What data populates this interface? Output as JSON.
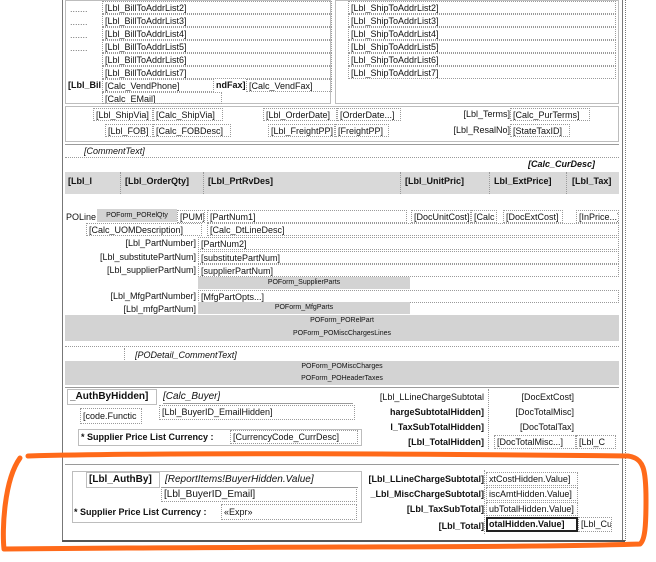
{
  "bill_to": {
    "small_labels": [
      ".......",
      ".......",
      ".......",
      "......."
    ],
    "lines": [
      "[Lbl_BillToAddrList2]",
      "[Lbl_BillToAddrList3]",
      "[Lbl_BillToAddrList4]",
      "[Lbl_BillToAddrList5]",
      "[Lbl_BillToAddrList6]",
      "[Lbl_BillToAddrList7]"
    ],
    "vend_phone_label": "[Lbl_Bil",
    "vend_phone": "[Calc_VendPhone]",
    "vend_fax_label": "ndFax]",
    "vend_fax": "[Calc_VendFax]",
    "email": "[Calc_EMail]"
  },
  "ship_to": {
    "lines": [
      "[Lbl_ShipToAddrList2]",
      "[Lbl_ShipToAddrList3]",
      "[Lbl_ShipToAddrList4]",
      "[Lbl_ShipToAddrList5]",
      "[Lbl_ShipToAddrList6]",
      "[Lbl_ShipToAddrList7]"
    ]
  },
  "order_info": {
    "ship_via_label": "[Lbl_ShipVia]",
    "ship_via": "[Calc_ShipVia]",
    "order_date_label": "[Lbl_OrderDate]",
    "order_date": "[OrderDate...]",
    "terms_label": "[Lbl_Terms]",
    "terms": "[Calc_PurTerms]",
    "fob_label": "[Lbl_FOB]",
    "fob": "[Calc_FOBDesc]",
    "freight_label": "[Lbl_FreightPP]",
    "freight": "[FreightPP]",
    "resal_label": "[Lbl_ResalNo]",
    "resal": "[StateTaxID]"
  },
  "comment_text": "[CommentText]",
  "cur_desc": "[Calc_CurDesc]",
  "columns": {
    "line": "[Lbl_l",
    "qty": "[Lbl_OrderQty]",
    "part": "[Lbl_PrtRvDes]",
    "unit_price": "[Lbl_UnitPric]",
    "ext_price": "Lbl_ExtPrice]",
    "tax": "[Lbl_Tax]"
  },
  "detail": {
    "po_line": "POLine",
    "po_rel_qty": "POForm_PORelQty",
    "pum": "[PUM]",
    "part_num1": "[PartNum1]",
    "doc_unit_cost": "[DocUnitCost]",
    "calc": "[Calc",
    "doc_ext_cost": "[DocExtCost]",
    "in_price": "[InPrice...]",
    "uom_desc": "[Calc_UOMDescription]",
    "dt_line_desc": "[Calc_DtLineDesc]",
    "part_number_label": "[Lbl_PartNumber]",
    "part_num2": "[PartNum2]",
    "substitute_label": "[Lbl_substitutePartNum]",
    "substitute": "[substitutePartNum]",
    "supplier_label": "[Lbl_supplierPartNum]",
    "supplier": "[supplierPartNum]",
    "supplier_parts": "POForm_SupplierParts",
    "mfg_label": "[Lbl_MfgPartNumber]",
    "mfg_opts": "[MfgPartOpts...]",
    "mfg_num_label": "[Lbl_mfgPartNum]",
    "mfg_parts": "POForm_MfgParts",
    "po_rel_part": "POForm_PORelPart",
    "misc_lines": "POForm_POMiscChargesLines",
    "po_detail_comment": "[PODetail_CommentText]",
    "misc_charges": "POForm_POMiscCharges",
    "header_taxes": "POForm_POHeaderTaxes"
  },
  "totals_upper": {
    "auth_by": "_AuthByHidden]",
    "calc_buyer": "[Calc_Buyer]",
    "code_func": "[code.Functic",
    "buyer_email": "[Lbl_BuyerID_EmailHidden]",
    "supplier_price_label": "* Supplier Price List Currency :",
    "currency": "[CurrencyCode_CurrDesc]",
    "line_charge_label": "[Lbl_LLineChargeSubtotal",
    "misc_charge_label": "hargeSubtotalHidden]",
    "tax_sub_label": "l_TaxSubTotalHidden]",
    "total_label": "[Lbl_TotalHidden]",
    "doc_ext_cost": "[DocExtCost]",
    "doc_total_misc": "[DocTotalMisc]",
    "doc_total_tax": "[DocTotalTax]",
    "doc_total_misc2": "[DocTotalMisc...]",
    "lbl_c": "[Lbl_C"
  },
  "totals_lower": {
    "auth_by": "[Lbl_AuthBy]",
    "buyer_hidden": "[ReportItems!BuyerHidden.Value]",
    "buyer_email": "[Lbl_BuyerID_Email]",
    "supplier_price_label": "* Supplier Price List Currency :",
    "expr": "«Expr»",
    "line_charge_label": "[Lbl_LLineChargeSubtotal]",
    "misc_charge_label": "_Lbl_MiscChargeSubtotal]",
    "tax_sub_label": "[Lbl_TaxSubTotal]",
    "total_label": "[Lbl_Total]",
    "ext_cost_hidden": "xtCostHidden.Value]",
    "misc_amt_hidden": "iscAmtHidden.Value]",
    "tax_total_hidden": "ubTotalHidden.Value]",
    "total_hidden": "otalHidden.Value]",
    "lbl_cu": "[Lbl_Cu"
  },
  "colors": {
    "annotation": "#ff6a1a",
    "band": "#d3d3d3",
    "header_bg": "#d9d9d9"
  }
}
